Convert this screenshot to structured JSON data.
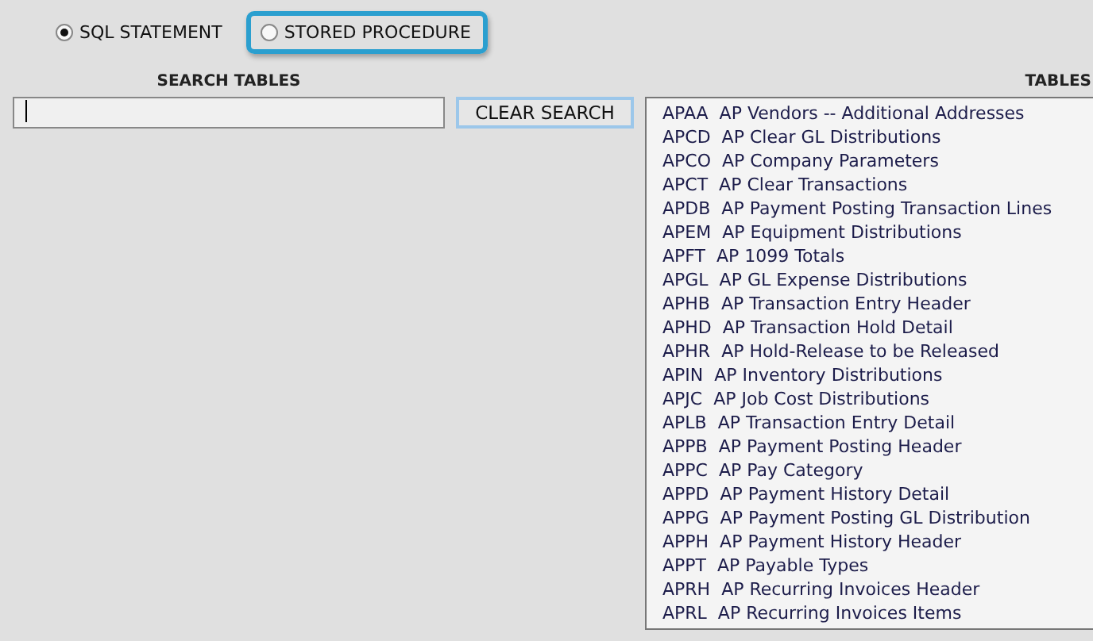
{
  "query_type": [
    {
      "label": "SQL STATEMENT",
      "selected": true,
      "highlighted": false
    },
    {
      "label": "STORED PROCEDURE",
      "selected": false,
      "highlighted": true
    }
  ],
  "search": {
    "heading": "SEARCH TABLES",
    "clear_button": "CLEAR SEARCH"
  },
  "tables": {
    "heading": "TABLES",
    "items": [
      "APAA  AP Vendors -- Additional Addresses",
      "APCD  AP Clear GL Distributions",
      "APCO  AP Company Parameters",
      "APCT  AP Clear Transactions",
      "APDB  AP Payment Posting Transaction Lines",
      "APEM  AP Equipment Distributions",
      "APFT  AP 1099 Totals",
      "APGL  AP GL Expense Distributions",
      "APHB  AP Transaction Entry Header",
      "APHD  AP Transaction Hold Detail",
      "APHR  AP Hold-Release to be Released",
      "APIN  AP Inventory Distributions",
      "APJC  AP Job Cost Distributions",
      "APLB  AP Transaction Entry Detail",
      "APPB  AP Payment Posting Header",
      "APPC  AP Pay Category",
      "APPD  AP Payment History Detail",
      "APPG  AP Payment Posting GL Distribution",
      "APPH  AP Payment History Header",
      "APPT  AP Payable Types",
      "APRH  AP Recurring Invoices Header",
      "APRL  AP Recurring Invoices Items"
    ]
  }
}
